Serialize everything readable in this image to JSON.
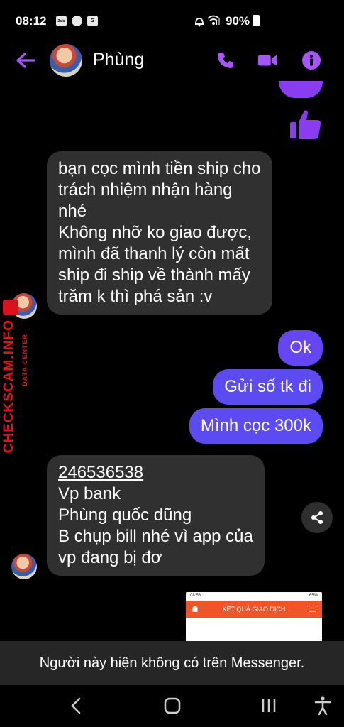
{
  "status_bar": {
    "time": "08:12",
    "battery": "90%",
    "left_icons": [
      "Zalo",
      "messenger-icon",
      "translate-icon"
    ],
    "right_icons": [
      "alarm-icon",
      "wifi-icon",
      "signal-icon",
      "battery-icon"
    ]
  },
  "header": {
    "contact_name": "Phùng",
    "accent": "#a855f7",
    "actions": [
      "phone-icon",
      "video-icon",
      "info-icon"
    ]
  },
  "messages": [
    {
      "from": "contact",
      "lines": [
        "bạn cọc mình tiền ship cho",
        "trách nhiệm nhận hàng",
        "nhé",
        "Không nhỡ ko giao được,",
        "mình đã thanh lý còn mất",
        "ship đi ship về thành mấy",
        "trăm k thì phá sản :v"
      ]
    },
    {
      "from": "me",
      "text": "Ok"
    },
    {
      "from": "me",
      "text": "Gửi số tk đi"
    },
    {
      "from": "me",
      "text": "Mình cọc 300k"
    },
    {
      "from": "contact",
      "account_number": "246536538",
      "lines": [
        "Vp bank",
        "Phùng quốc dũng",
        "B chụp bill nhé vì app của",
        "vp đang bị đơ"
      ]
    }
  ],
  "image_preview": {
    "time": "08:56",
    "battery": "65%",
    "title": "KẾT QUẢ GIAO DỊCH"
  },
  "watermark": {
    "brand": "CHECKSCAM.INFO",
    "sub": "DATA CENTER"
  },
  "banner": {
    "text": "Người này hiện không có trên Messenger."
  },
  "colors": {
    "outgoing_bubble": "#5b4bf0",
    "incoming_bubble": "#303030",
    "brand_red": "#e3121b"
  }
}
